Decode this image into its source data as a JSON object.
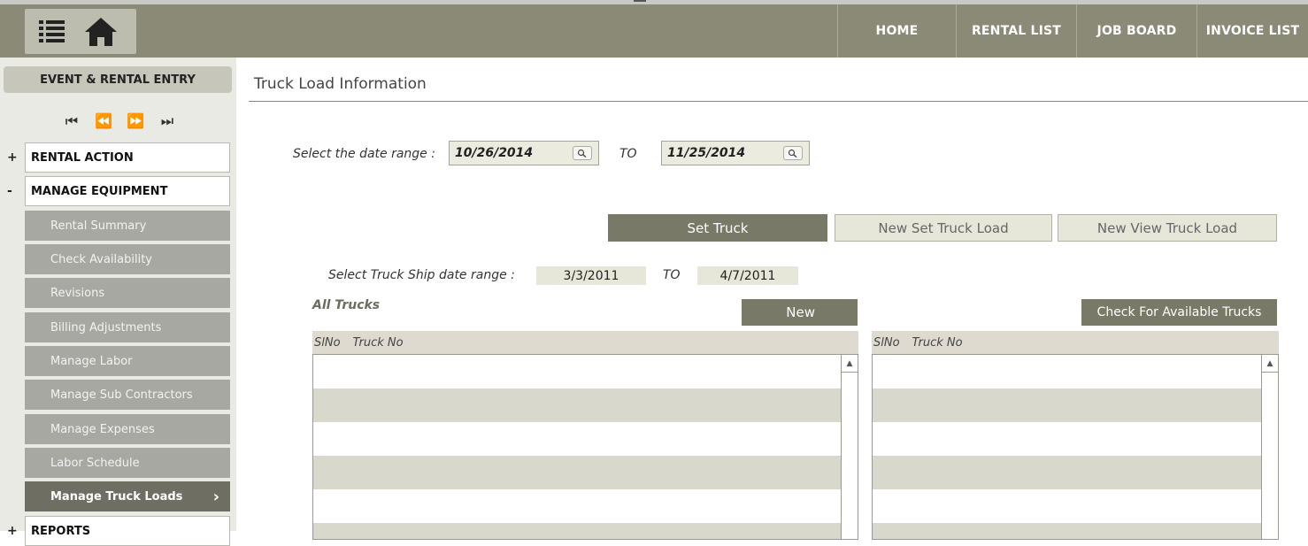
{
  "header": {
    "nav": [
      "HOME",
      "RENTAL LIST",
      "JOB BOARD",
      "INVOICE LIST"
    ],
    "icons": [
      "list-icon",
      "home-icon"
    ]
  },
  "sidebar": {
    "title": "EVENT & RENTAL ENTRY",
    "media": [
      "⏮",
      "⏪",
      "⏩",
      "⏭"
    ],
    "sections": [
      {
        "sign": "+",
        "label": "RENTAL ACTION"
      },
      {
        "sign": "-",
        "label": "MANAGE EQUIPMENT"
      },
      {
        "sign": "+",
        "label": "REPORTS"
      }
    ],
    "items": [
      "Rental Summary",
      "Check Availability",
      "Revisions",
      "Billing Adjustments",
      "Manage Labor",
      "Manage Sub Contractors",
      "Manage Expenses",
      "Labor Schedule",
      "Manage Truck Loads"
    ],
    "active_item": "Manage Truck Loads"
  },
  "main": {
    "title": "Truck Load Information",
    "date_range_label": "Select the date range :",
    "date_from": "10/26/2014",
    "to_label": "TO",
    "date_to": "11/25/2014",
    "buttons": {
      "set_truck": "Set Truck",
      "new_set_truck_load": "New Set Truck Load",
      "new_view_truck_load": "New View Truck Load"
    },
    "ship_range_label": "Select Truck Ship date range :",
    "ship_from": "3/3/2011",
    "ship_to_label": "TO",
    "ship_to": "4/7/2011",
    "all_trucks_label": "All Trucks",
    "new_button": "New",
    "check_available_button": "Check For Available Trucks",
    "left_grid_header": [
      "SlNo",
      "Truck No"
    ],
    "right_grid_header": [
      "SlNo",
      "Truck No"
    ]
  },
  "colors": {
    "header_bg": "#8a8a77",
    "dark_button": "#797968",
    "light_button": "#e6e6d9",
    "sidebar_item": "#a8a8a2",
    "sidebar_active": "#6e6e62"
  }
}
